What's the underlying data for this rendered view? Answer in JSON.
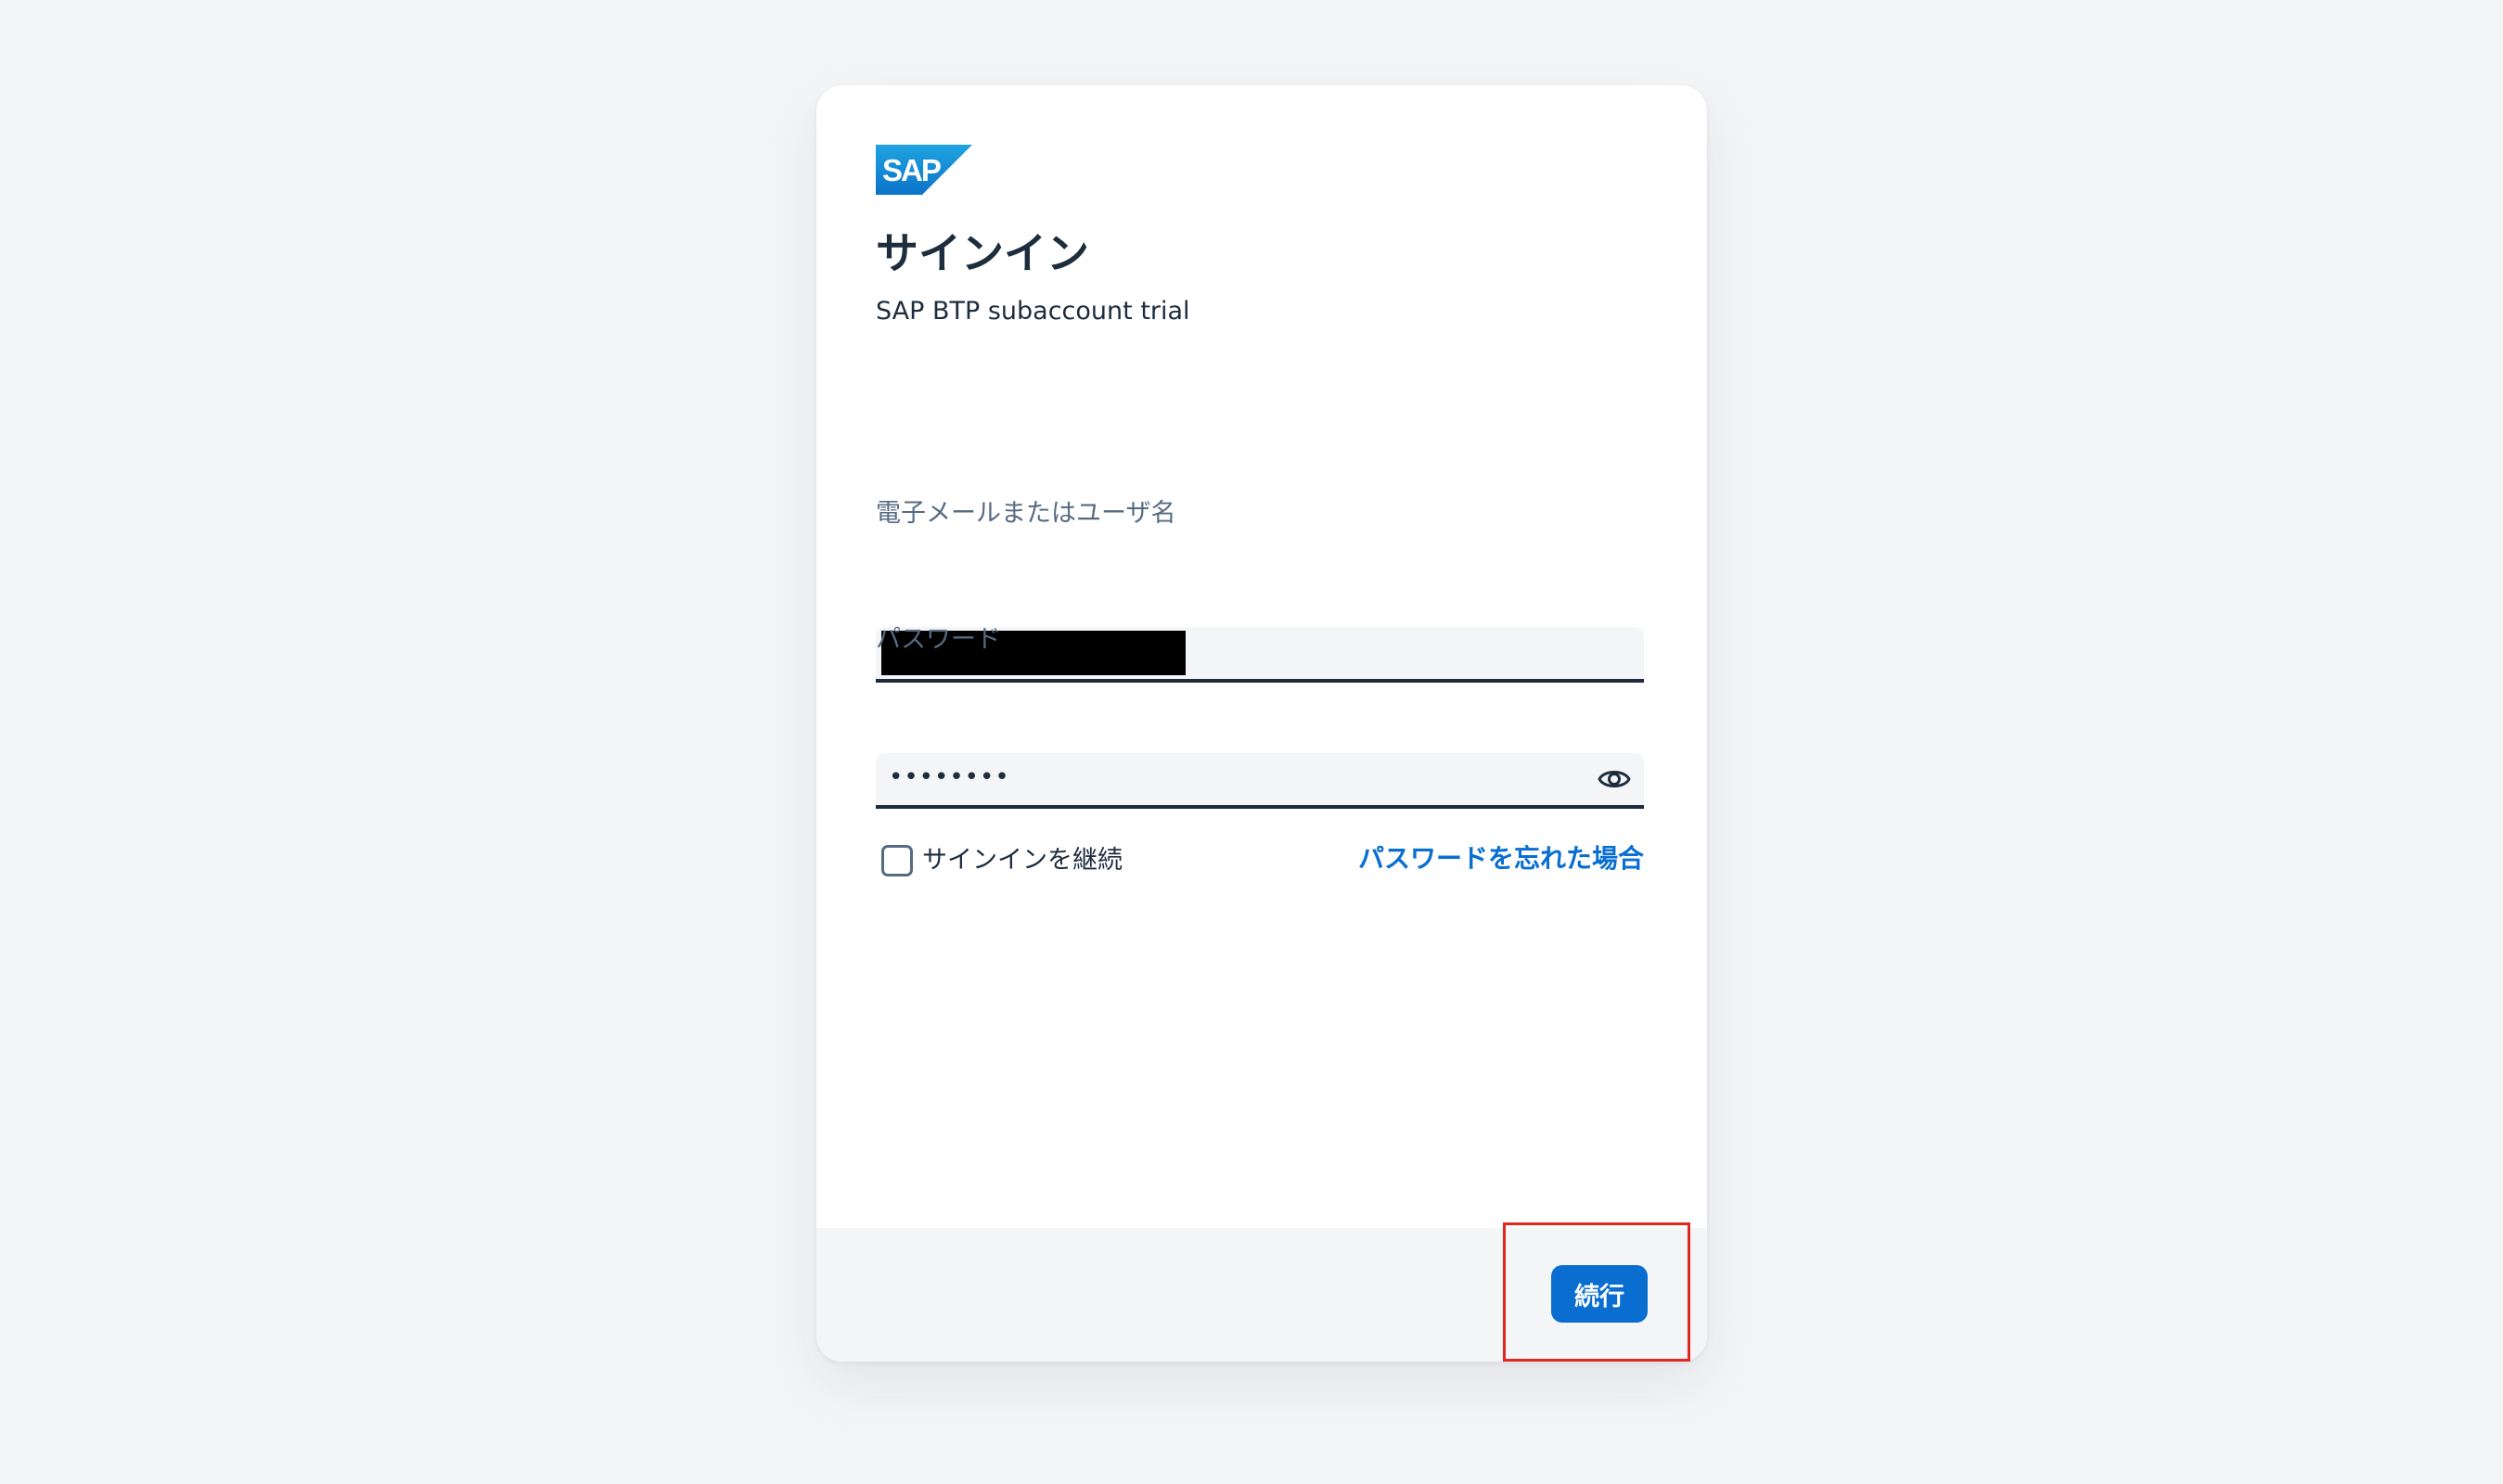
{
  "logo": {
    "text": "SAP",
    "colors": [
      "#1fa4e0",
      "#0b73c9"
    ]
  },
  "title": "サインイン",
  "subtitle": "SAP BTP subaccount trial",
  "form": {
    "email_label": "電子メールまたはユーザ名",
    "email_value": "",
    "password_label": "パスワード",
    "password_value": "••••••••",
    "password_toggle_icon": "eye-icon",
    "remember_label": "サインインを継続",
    "remember_checked": false,
    "forgot_link": "パスワードを忘れた場合"
  },
  "footer": {
    "continue_label": "続行"
  },
  "colors": {
    "accent": "#0a6ed1",
    "text": "#1d2d3e",
    "muted": "#556b82",
    "highlight": "#e0281e"
  }
}
